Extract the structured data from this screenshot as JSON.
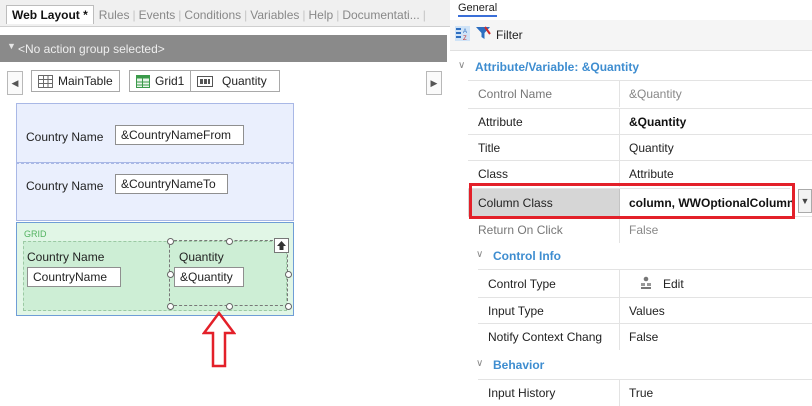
{
  "tabs": {
    "active": "Web Layout *",
    "others": [
      "Rules",
      "Events",
      "Conditions",
      "Variables",
      "Help",
      "Documentati..."
    ]
  },
  "action_group": {
    "label": "<No action group selected>"
  },
  "breadcrumb": {
    "items": [
      {
        "label": "MainTable",
        "icon": "table-icon"
      },
      {
        "label": "Grid1",
        "icon": "grid-icon"
      },
      {
        "label": "Quantity",
        "icon": "edit-field-icon"
      }
    ]
  },
  "layout": {
    "row1": {
      "label": "Country Name",
      "field": "&CountryNameFrom"
    },
    "row2": {
      "label": "Country Name",
      "field": "&CountryNameTo"
    },
    "grid": {
      "caption": "GRID",
      "col1": {
        "header": "Country Name",
        "cell": "CountryName"
      },
      "col2": {
        "header": "Quantity",
        "cell": "&Quantity"
      }
    }
  },
  "properties": {
    "title": "General",
    "filter_label": "Filter",
    "group1": {
      "title": "Attribute/Variable: &Quantity",
      "rows": [
        {
          "name": "Control Name",
          "value": "&Quantity"
        },
        {
          "name": "Attribute",
          "value": "&Quantity"
        },
        {
          "name": "Title",
          "value": "Quantity"
        },
        {
          "name": "Class",
          "value": "Attribute"
        },
        {
          "name": "Column Class",
          "value": "column, WWOptionalColumn"
        },
        {
          "name": "Return On Click",
          "value": "False"
        }
      ]
    },
    "group2": {
      "title": "Control Info",
      "rows": [
        {
          "name": "Control Type",
          "value": "Edit"
        },
        {
          "name": "Input Type",
          "value": "Values"
        },
        {
          "name": "Notify Context Chang",
          "value": "False"
        }
      ]
    },
    "group3": {
      "title": "Behavior",
      "rows": [
        {
          "name": "Input History",
          "value": "True"
        }
      ]
    }
  },
  "colors": {
    "highlight": "#e32029",
    "accent": "#3e8dd0",
    "grid_green": "#53b361"
  }
}
